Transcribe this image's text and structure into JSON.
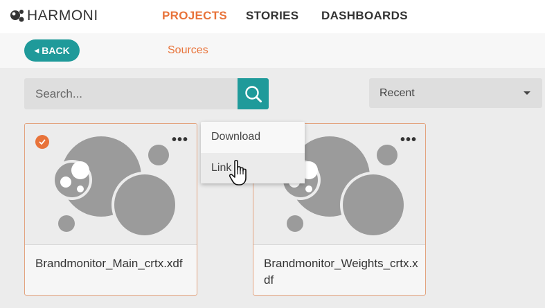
{
  "app": {
    "logo_text": "HARMONI"
  },
  "nav": {
    "items": [
      {
        "label": "PROJECTS",
        "active": true
      },
      {
        "label": "STORIES",
        "active": false
      },
      {
        "label": "DASHBOARDS",
        "active": false
      }
    ]
  },
  "subnav": {
    "back_label": "BACK",
    "sources_label": "Sources"
  },
  "search": {
    "placeholder": "Search...",
    "icon": "search-icon"
  },
  "sort": {
    "selected": "Recent"
  },
  "cards": [
    {
      "name": "Brandmonitor_Main_crtx.xdf",
      "selected": true
    },
    {
      "name": "Brandmonitor_Weights_crtx.xdf",
      "selected": false
    }
  ],
  "context_menu": {
    "items": [
      "Download",
      "Link"
    ],
    "hovered": "Link"
  },
  "colors": {
    "accent": "#e8733a",
    "teal": "#1f9a9a",
    "bubble": "#9b9b9b"
  }
}
